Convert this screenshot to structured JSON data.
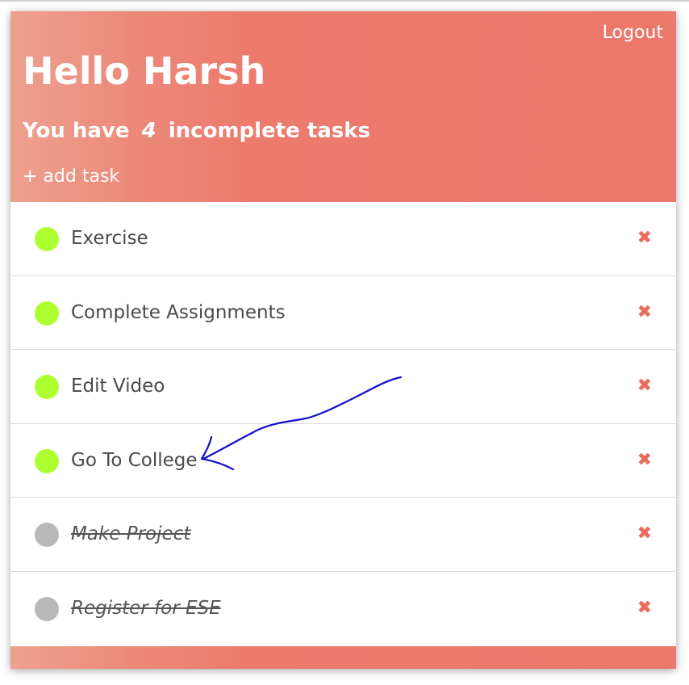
{
  "header": {
    "logout_label": "Logout",
    "greeting": "Hello Harsh",
    "incomplete_prefix": "You have",
    "incomplete_count": "4",
    "incomplete_suffix": "incomplete tasks",
    "add_task_label": "+ add task"
  },
  "tasks": [
    {
      "label": "Exercise",
      "completed": false
    },
    {
      "label": "Complete Assignments",
      "completed": false
    },
    {
      "label": "Edit Video",
      "completed": false
    },
    {
      "label": "Go To College",
      "completed": false
    },
    {
      "label": "Make Project",
      "completed": true
    },
    {
      "label": "Register for ESE",
      "completed": true
    }
  ],
  "delete_glyph": "✖",
  "colors": {
    "accent": "#ec786c",
    "incomplete_dot": "#adff2f",
    "complete_dot": "#b9b9b9",
    "delete": "#ec6a5a",
    "annotation_arrow": "#1010c8"
  }
}
